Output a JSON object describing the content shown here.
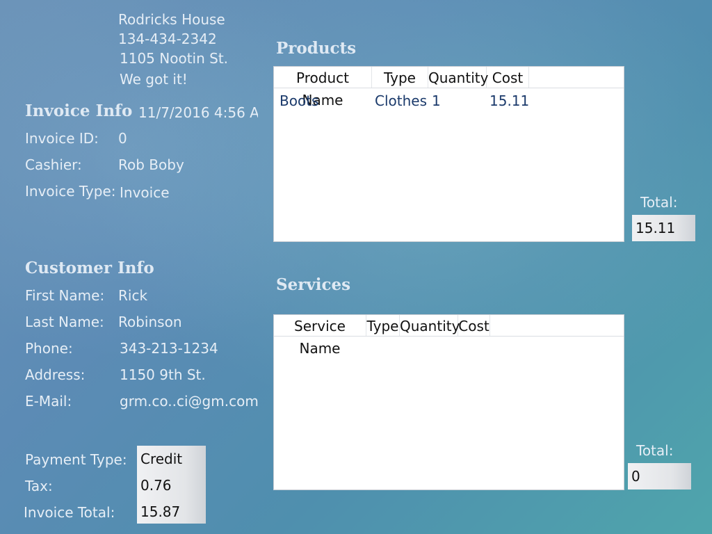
{
  "store": {
    "name": "Rodricks House",
    "phone": "134-434-2342",
    "address": "1105 Nootin St.",
    "slogan": "We got it!"
  },
  "invoice_info": {
    "heading": "Invoice Info",
    "datetime": "11/7/2016 4:56 AM",
    "fields": [
      {
        "label": "Invoice ID:",
        "value": "0"
      },
      {
        "label": "Cashier:",
        "value": "Rob Boby"
      },
      {
        "label": "Invoice Type:",
        "value": "Invoice"
      }
    ]
  },
  "customer_info": {
    "heading": "Customer Info",
    "fields": [
      {
        "label": "First Name:",
        "value": "Rick"
      },
      {
        "label": "Last Name:",
        "value": "Robinson"
      },
      {
        "label": "Phone:",
        "value": "343-213-1234"
      },
      {
        "label": "Address:",
        "value": "1150 9th St."
      },
      {
        "label": "E-Mail:",
        "value": "grm.co..ci@gm.com"
      }
    ]
  },
  "payment": {
    "type_label": "Payment Type:",
    "type_value": "Credit",
    "tax_label": "Tax:",
    "tax_value": "0.76",
    "total_label": "Invoice Total:",
    "total_value": "15.87"
  },
  "products": {
    "heading": "Products",
    "columns": [
      "Product Name",
      "Type",
      "Quantity",
      "Cost"
    ],
    "rows": [
      {
        "name": "Boots",
        "type": "Clothes",
        "quantity": "1",
        "cost": "15.11"
      }
    ],
    "total_label": "Total:",
    "total_value": "15.11"
  },
  "services": {
    "heading": "Services",
    "columns": [
      "Service Name",
      "Type",
      "Quantity",
      "Cost"
    ],
    "rows": [],
    "total_label": "Total:",
    "total_value": "0"
  }
}
